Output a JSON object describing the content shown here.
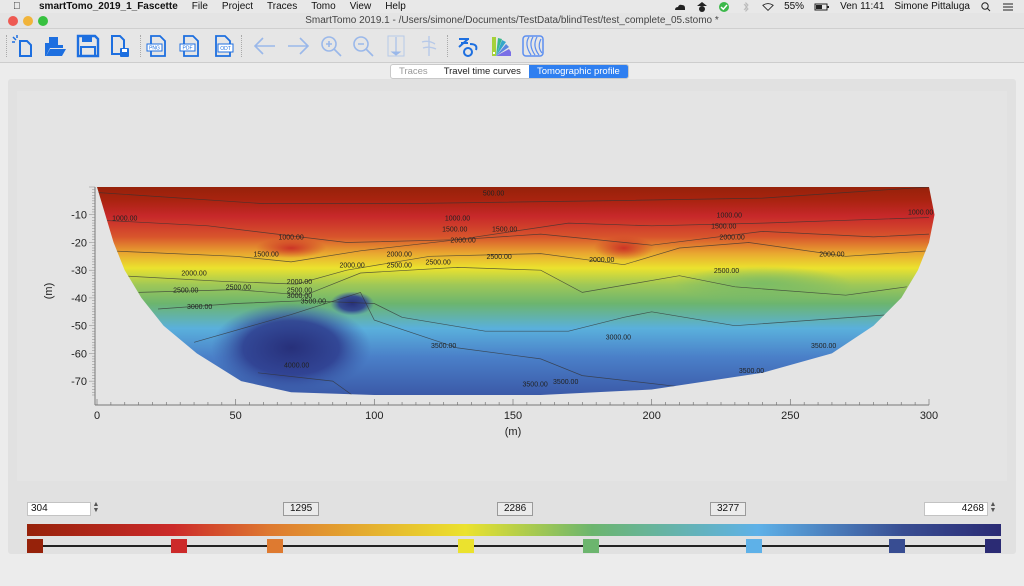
{
  "menubar": {
    "app_name": "smartTomo_2019_1_Fascette",
    "items": [
      "File",
      "Project",
      "Traces",
      "Tomo",
      "View",
      "Help"
    ],
    "battery": "55%",
    "clock": "Ven 11:41",
    "user": "Simone Pittaluga"
  },
  "window": {
    "title": "SmartTomo 2019.1 - /Users/simone/Documents/TestData/blindTest/test_complete_05.stomo *"
  },
  "toolbar": {
    "buttons": [
      {
        "name": "new-project",
        "icon": "new-file-icon",
        "enabled": true
      },
      {
        "name": "open-project",
        "icon": "open-folder-icon",
        "enabled": true
      },
      {
        "name": "save-project",
        "icon": "save-icon",
        "enabled": true
      },
      {
        "name": "save-as",
        "icon": "save-as-icon",
        "enabled": true
      },
      {
        "name": "export-png",
        "icon": "export-png-icon",
        "label": "PNG",
        "enabled": true
      },
      {
        "name": "export-pdf",
        "icon": "export-pdf-icon",
        "label": "PDF",
        "enabled": true
      },
      {
        "name": "export-odt",
        "icon": "export-odt-icon",
        "label": "ODT",
        "enabled": true
      },
      {
        "name": "back",
        "icon": "arrow-left-icon",
        "enabled": false
      },
      {
        "name": "forward",
        "icon": "arrow-right-icon",
        "enabled": false
      },
      {
        "name": "zoom-in",
        "icon": "zoom-in-icon",
        "enabled": false
      },
      {
        "name": "zoom-out",
        "icon": "zoom-out-icon",
        "enabled": false
      },
      {
        "name": "picking",
        "icon": "picking-icon",
        "enabled": false
      },
      {
        "name": "traces-align",
        "icon": "traces-icon",
        "enabled": false
      },
      {
        "name": "inversion-settings",
        "icon": "inversion-icon",
        "enabled": true
      },
      {
        "name": "color-palette",
        "icon": "palette-icon",
        "enabled": true
      },
      {
        "name": "contours",
        "icon": "contours-icon",
        "enabled": true
      }
    ]
  },
  "tabs": [
    {
      "label": "Traces",
      "state": "disabled"
    },
    {
      "label": "Travel time curves",
      "state": "normal"
    },
    {
      "label": "Tomographic profile",
      "state": "active"
    }
  ],
  "chart_data": {
    "type": "heatmap",
    "title": "Tomographic profile",
    "xlabel": "(m)",
    "ylabel": "(m)",
    "xlim": [
      0,
      300
    ],
    "ylim": [
      -75,
      0
    ],
    "x_ticks": [
      "0",
      "50",
      "100",
      "150",
      "200",
      "250",
      "300"
    ],
    "y_ticks": [
      "-10",
      "-20",
      "-30",
      "-40",
      "-50",
      "-60",
      "-70"
    ],
    "value_range": [
      304,
      4268
    ],
    "contour_levels": [
      500,
      1000,
      1500,
      2000,
      2500,
      3000,
      3500,
      4000
    ],
    "contour_labels": [
      {
        "text": "500.00",
        "x": 143,
        "y": -3
      },
      {
        "text": "1000.00",
        "x": 10,
        "y": -12
      },
      {
        "text": "1000.00",
        "x": 70,
        "y": -19
      },
      {
        "text": "1000.00",
        "x": 130,
        "y": -12
      },
      {
        "text": "1000.00",
        "x": 228,
        "y": -11
      },
      {
        "text": "1000.00",
        "x": 297,
        "y": -10
      },
      {
        "text": "1500.00",
        "x": 61,
        "y": -25
      },
      {
        "text": "1500.00",
        "x": 129,
        "y": -16
      },
      {
        "text": "1500.00",
        "x": 147,
        "y": -16
      },
      {
        "text": "1500.00",
        "x": 226,
        "y": -15
      },
      {
        "text": "2000.00",
        "x": 35,
        "y": -32
      },
      {
        "text": "2000.00",
        "x": 73,
        "y": -35
      },
      {
        "text": "2000.00",
        "x": 92,
        "y": -29
      },
      {
        "text": "2000.00",
        "x": 109,
        "y": -25
      },
      {
        "text": "2000.00",
        "x": 132,
        "y": -20
      },
      {
        "text": "2000.00",
        "x": 182,
        "y": -27
      },
      {
        "text": "2000.00",
        "x": 229,
        "y": -19
      },
      {
        "text": "2000.00",
        "x": 265,
        "y": -25
      },
      {
        "text": "2500.00",
        "x": 32,
        "y": -38
      },
      {
        "text": "2500.00",
        "x": 51,
        "y": -37
      },
      {
        "text": "2500.00",
        "x": 73,
        "y": -38
      },
      {
        "text": "2500.00",
        "x": 109,
        "y": -29
      },
      {
        "text": "2500.00",
        "x": 123,
        "y": -28
      },
      {
        "text": "2500.00",
        "x": 145,
        "y": -26
      },
      {
        "text": "2500.00",
        "x": 227,
        "y": -31
      },
      {
        "text": "3000.00",
        "x": 37,
        "y": -44
      },
      {
        "text": "3000.00",
        "x": 73,
        "y": -40
      },
      {
        "text": "3000.00",
        "x": 188,
        "y": -55
      },
      {
        "text": "3500.00",
        "x": 78,
        "y": -42
      },
      {
        "text": "3500.00",
        "x": 125,
        "y": -58
      },
      {
        "text": "3500.00",
        "x": 158,
        "y": -72
      },
      {
        "text": "3500.00",
        "x": 169,
        "y": -71
      },
      {
        "text": "3500.00",
        "x": 236,
        "y": -67
      },
      {
        "text": "3500.00",
        "x": 262,
        "y": -58
      },
      {
        "text": "4000.00",
        "x": 72,
        "y": -65
      }
    ]
  },
  "colorscale": {
    "min_value": "304",
    "max_value": "4268",
    "ticks": [
      "1295",
      "2286",
      "3277"
    ],
    "stops": [
      {
        "pos": 0.0,
        "color": "#96220a"
      },
      {
        "pos": 0.15,
        "color": "#cc2a2a"
      },
      {
        "pos": 0.25,
        "color": "#de7a30"
      },
      {
        "pos": 0.45,
        "color": "#ebe22e"
      },
      {
        "pos": 0.58,
        "color": "#6cb56e"
      },
      {
        "pos": 0.75,
        "color": "#5eb1e8"
      },
      {
        "pos": 0.9,
        "color": "#384d92"
      },
      {
        "pos": 1.0,
        "color": "#2b2b74"
      }
    ]
  }
}
